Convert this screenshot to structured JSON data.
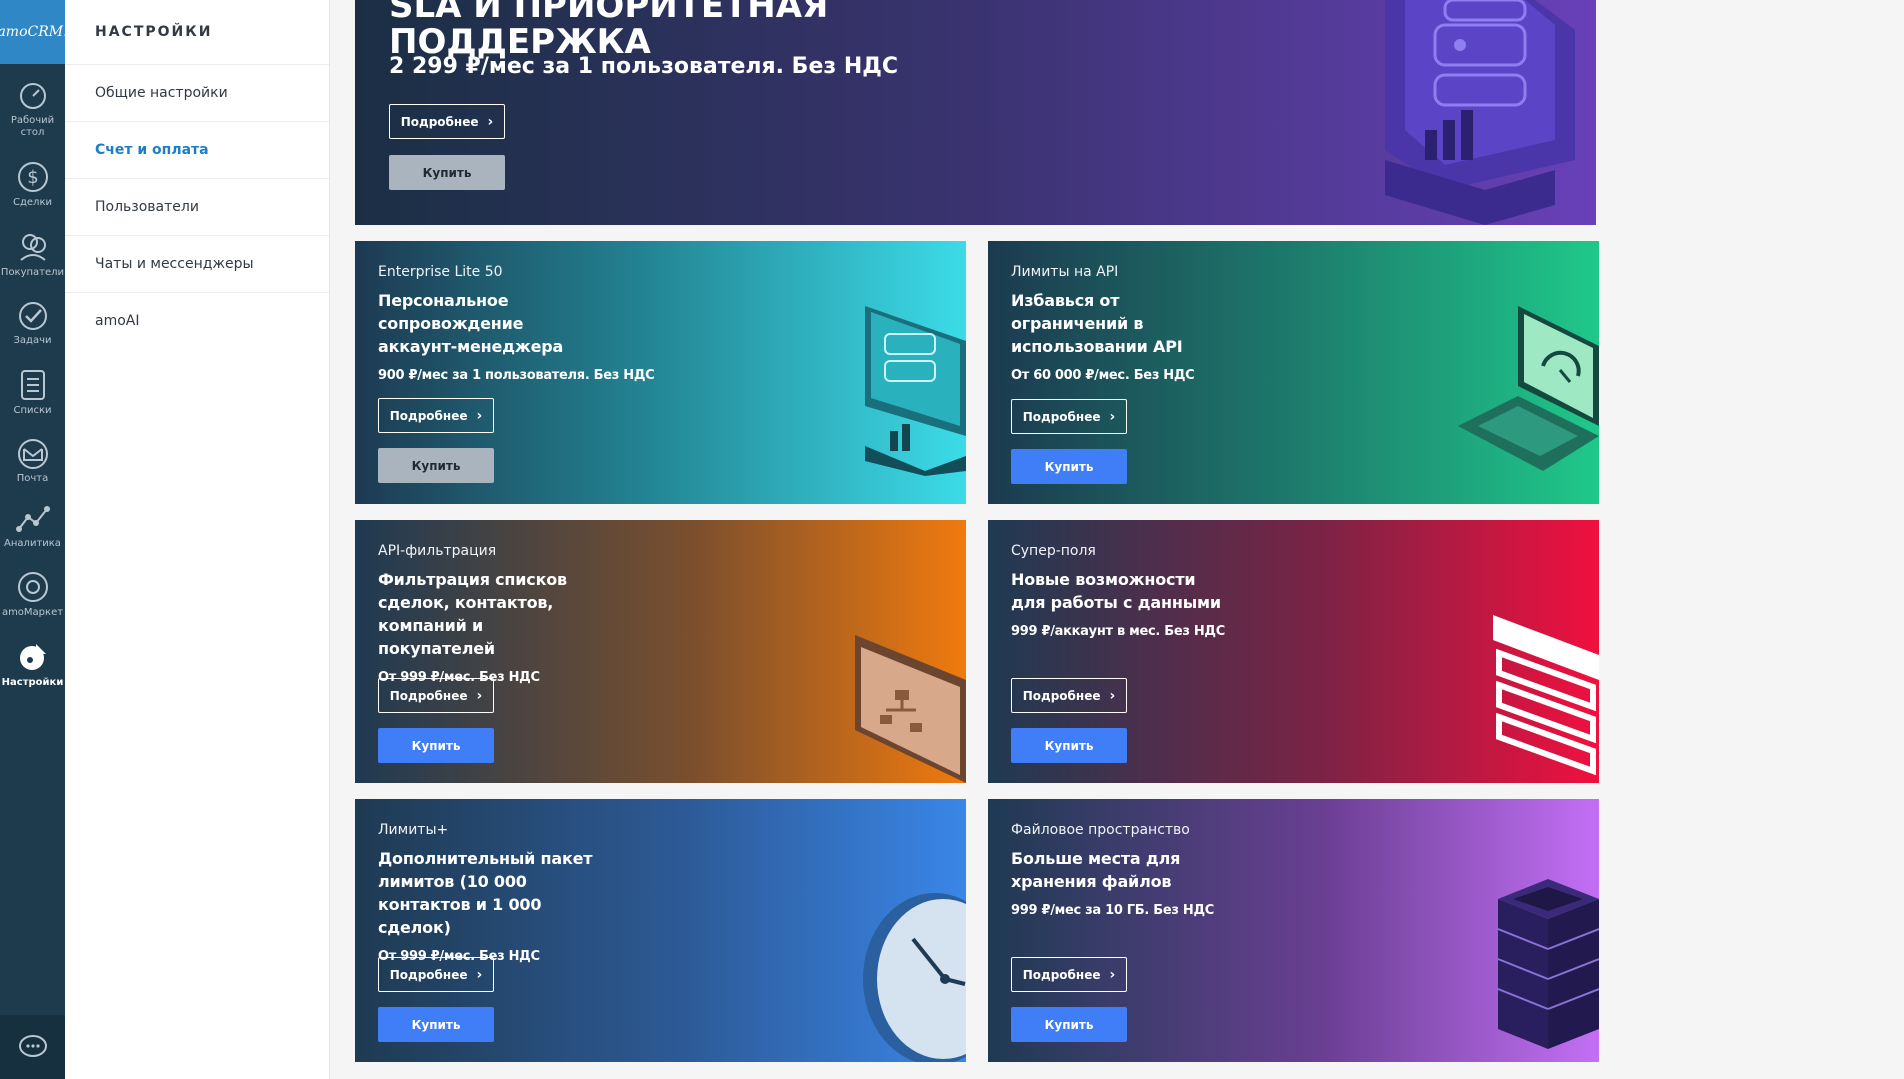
{
  "rail": {
    "logo": "amoCRM.",
    "items": [
      {
        "label": "Рабочий стол",
        "icon": "dashboard-icon"
      },
      {
        "label": "Сделки",
        "icon": "dollar-icon"
      },
      {
        "label": "Покупатели",
        "icon": "customers-icon"
      },
      {
        "label": "Задачи",
        "icon": "checkmark-icon"
      },
      {
        "label": "Списки",
        "icon": "list-icon"
      },
      {
        "label": "Почта",
        "icon": "mail-icon"
      },
      {
        "label": "Аналитика",
        "icon": "analytics-icon"
      },
      {
        "label": "amoМаркет",
        "icon": "market-icon"
      },
      {
        "label": "Настройки",
        "icon": "wrench-icon"
      }
    ]
  },
  "sidebar": {
    "title": "НАСТРОЙКИ",
    "items": [
      {
        "label": "Общие настройки"
      },
      {
        "label": "Счет и оплата",
        "active": true
      },
      {
        "label": "Пользователи"
      },
      {
        "label": "Чаты и мессенджеры"
      },
      {
        "label": "amoAI"
      }
    ]
  },
  "hero": {
    "title_line1": "SLA И ПРИОРИТЕТНАЯ",
    "title_line2": "ПОДДЕРЖКА",
    "price": "2 299 ₽/мес за 1 пользователя. Без НДС",
    "more": "Подробнее",
    "buy": "Купить"
  },
  "cards": [
    {
      "tag": "Enterprise Lite 50",
      "title": "Персональное сопровождение аккаунт-менеджера",
      "price": "900 ₽/мес за 1 пользователя. Без НДС",
      "more": "Подробнее",
      "buy": "Купить",
      "buy_disabled": true
    },
    {
      "tag": "Лимиты на API",
      "title": "Избавься от ограничений в использовании API",
      "price": "От 60 000 ₽/мес. Без НДС",
      "more": "Подробнее",
      "buy": "Купить"
    },
    {
      "tag": "API-фильтрация",
      "title": "Фильтрация списков сделок, контактов, компаний и покупателей",
      "price": "От 999 ₽/мес. Без НДС",
      "more": "Подробнее",
      "buy": "Купить"
    },
    {
      "tag": "Супер-поля",
      "title": "Новые возможности для работы с данными",
      "price": "999 ₽/аккаунт в мес. Без НДС",
      "more": "Подробнее",
      "buy": "Купить"
    },
    {
      "tag": "Лимиты+",
      "title": "Дополнительный пакет лимитов (10 000 контактов и 1 000 сделок)",
      "price": "От 999 ₽/мес. Без НДС",
      "more": "Подробнее",
      "buy": "Купить"
    },
    {
      "tag": "Файловое пространство",
      "title": "Больше места для хранения файлов",
      "price": "999 ₽/мес за 10 ГБ. Без НДС",
      "more": "Подробнее",
      "buy": "Купить"
    }
  ],
  "colors": {
    "rail": "#1e3a4d",
    "accent": "#1c7fc6",
    "buy_button": "#3f7ef7"
  }
}
